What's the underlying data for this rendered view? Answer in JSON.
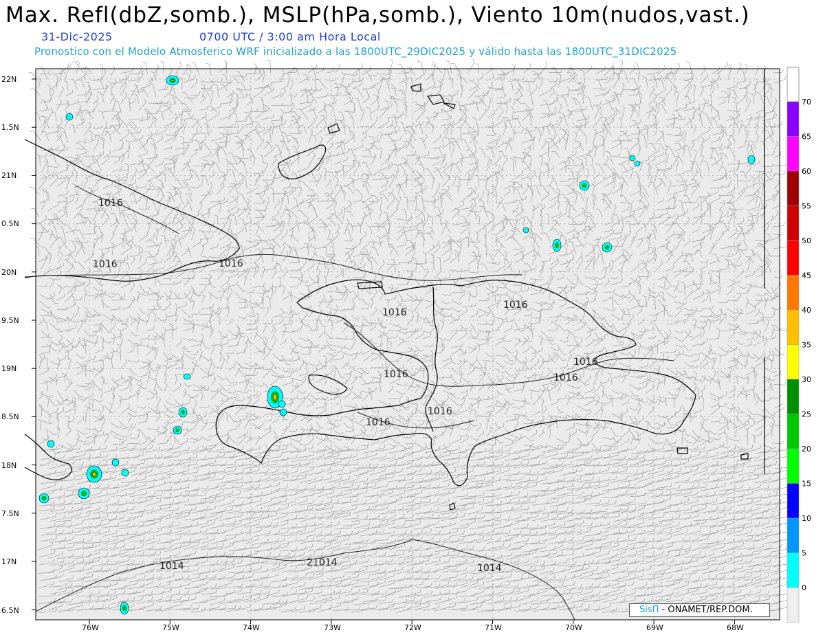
{
  "title": "Max. Refl(dbZ,somb.), MSLP(hPa,somb.), Viento 10m(nudos,vast.)",
  "date": "31-Dic-2025",
  "time_label": "0700 UTC / 3:00 am Hora Local",
  "description": "Pronostico con el Modelo Atmosferico WRF inicializado a las 1800UTC_29DIC2025 y válido hasta las  1800UTC_31DIC2025",
  "credit": {
    "logo": "SisΠ",
    "org": " - ONAMET/REP.DOM."
  },
  "axes": {
    "lat_ticks": [
      "22N",
      "1.5N",
      "21N",
      "0.5N",
      "20N",
      "9.5N",
      "19N",
      "8.5N",
      "18N",
      "7.5N",
      "17N",
      "6.5N"
    ],
    "lon_ticks": [
      "76W",
      "75W",
      "74W",
      "73W",
      "72W",
      "71W",
      "70W",
      "69W",
      "68W"
    ]
  },
  "isobar_labels": [
    "1016",
    "1016",
    "1016",
    "1016",
    "1016",
    "1016",
    "1016",
    "1016",
    "1016",
    "1016",
    "1014",
    "21014",
    "1014"
  ],
  "colorbar": {
    "labels": [
      "70",
      "65",
      "60",
      "55",
      "50",
      "45",
      "40",
      "35",
      "30",
      "25",
      "20",
      "15",
      "10",
      "5",
      "0"
    ],
    "colors": [
      "#8a00ff",
      "#ff00ff",
      "#a00000",
      "#cf0000",
      "#ff0000",
      "#ff7800",
      "#ffc000",
      "#ffff00",
      "#009100",
      "#00c800",
      "#00ff00",
      "#0000ff",
      "#0096ff",
      "#00ffff",
      "#eeeeee"
    ]
  },
  "map": {
    "background": "#ebebeb",
    "wind_color": "#9a9a9a",
    "coast_color": "#000000"
  }
}
